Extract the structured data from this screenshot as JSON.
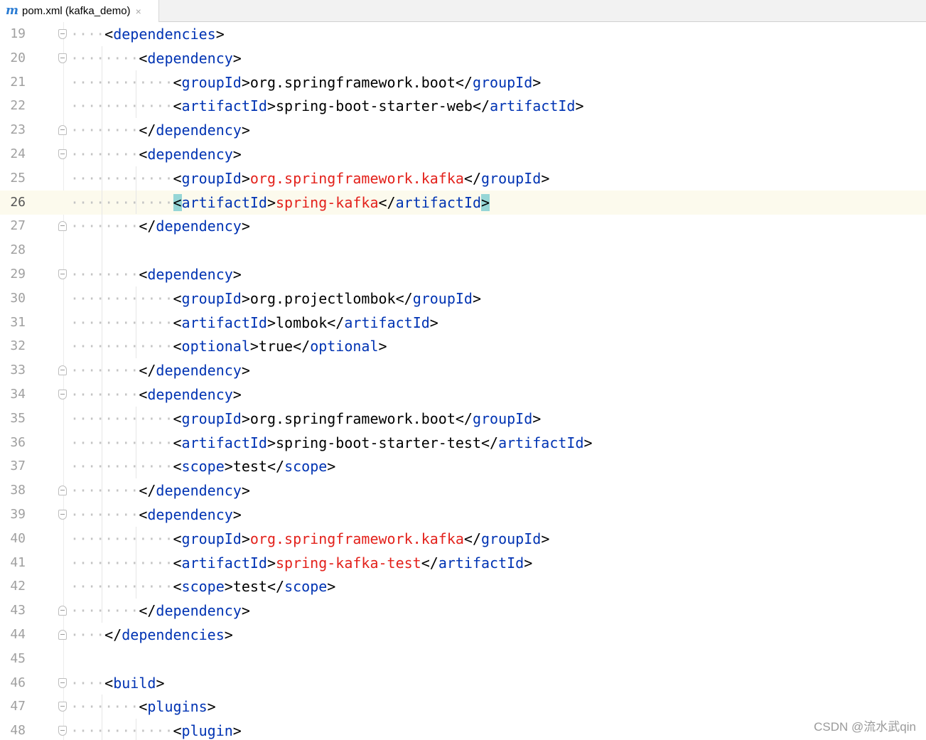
{
  "tab": {
    "icon": "maven-icon",
    "icon_glyph": "m",
    "title": "pom.xml (kafka_demo)",
    "close": "×"
  },
  "editor": {
    "current_line": "26",
    "lines": [
      {
        "no": "19",
        "dots": "····",
        "parts": [
          [
            "p",
            "<"
          ],
          [
            "t",
            "dependencies"
          ],
          [
            "p",
            ">"
          ]
        ]
      },
      {
        "no": "20",
        "dots": "········",
        "parts": [
          [
            "p",
            "<"
          ],
          [
            "t",
            "dependency"
          ],
          [
            "p",
            ">"
          ]
        ]
      },
      {
        "no": "21",
        "dots": "············",
        "parts": [
          [
            "p",
            "<"
          ],
          [
            "t",
            "groupId"
          ],
          [
            "p",
            ">"
          ],
          [
            "v",
            "org.springframework.boot"
          ],
          [
            "p",
            "</"
          ],
          [
            "t",
            "groupId"
          ],
          [
            "p",
            ">"
          ]
        ]
      },
      {
        "no": "22",
        "dots": "············",
        "parts": [
          [
            "p",
            "<"
          ],
          [
            "t",
            "artifactId"
          ],
          [
            "p",
            ">"
          ],
          [
            "v",
            "spring-boot-starter-web"
          ],
          [
            "p",
            "</"
          ],
          [
            "t",
            "artifactId"
          ],
          [
            "p",
            ">"
          ]
        ]
      },
      {
        "no": "23",
        "dots": "········",
        "parts": [
          [
            "p",
            "</"
          ],
          [
            "t",
            "dependency"
          ],
          [
            "p",
            ">"
          ]
        ]
      },
      {
        "no": "24",
        "dots": "········",
        "parts": [
          [
            "p",
            "<"
          ],
          [
            "t",
            "dependency"
          ],
          [
            "p",
            ">"
          ]
        ]
      },
      {
        "no": "25",
        "dots": "············",
        "parts": [
          [
            "p",
            "<"
          ],
          [
            "t",
            "groupId"
          ],
          [
            "p",
            ">"
          ],
          [
            "k",
            "org.springframework.kafka"
          ],
          [
            "p",
            "</"
          ],
          [
            "t",
            "groupId"
          ],
          [
            "p",
            ">"
          ]
        ]
      },
      {
        "no": "26",
        "dots": "············",
        "parts": [
          [
            "b",
            "<"
          ],
          [
            "t",
            "artifactId"
          ],
          [
            "p",
            ">"
          ],
          [
            "k",
            "spring-kafka"
          ],
          [
            "p",
            "</"
          ],
          [
            "t",
            "artifactId"
          ],
          [
            "b",
            ">"
          ]
        ]
      },
      {
        "no": "27",
        "dots": "········",
        "parts": [
          [
            "p",
            "</"
          ],
          [
            "t",
            "dependency"
          ],
          [
            "p",
            ">"
          ]
        ]
      },
      {
        "no": "28",
        "dots": "",
        "parts": []
      },
      {
        "no": "29",
        "dots": "········",
        "parts": [
          [
            "p",
            "<"
          ],
          [
            "t",
            "dependency"
          ],
          [
            "p",
            ">"
          ]
        ]
      },
      {
        "no": "30",
        "dots": "············",
        "parts": [
          [
            "p",
            "<"
          ],
          [
            "t",
            "groupId"
          ],
          [
            "p",
            ">"
          ],
          [
            "v",
            "org.projectlombok"
          ],
          [
            "p",
            "</"
          ],
          [
            "t",
            "groupId"
          ],
          [
            "p",
            ">"
          ]
        ]
      },
      {
        "no": "31",
        "dots": "············",
        "parts": [
          [
            "p",
            "<"
          ],
          [
            "t",
            "artifactId"
          ],
          [
            "p",
            ">"
          ],
          [
            "v",
            "lombok"
          ],
          [
            "p",
            "</"
          ],
          [
            "t",
            "artifactId"
          ],
          [
            "p",
            ">"
          ]
        ]
      },
      {
        "no": "32",
        "dots": "············",
        "parts": [
          [
            "p",
            "<"
          ],
          [
            "t",
            "optional"
          ],
          [
            "p",
            ">"
          ],
          [
            "v",
            "true"
          ],
          [
            "p",
            "</"
          ],
          [
            "t",
            "optional"
          ],
          [
            "p",
            ">"
          ]
        ]
      },
      {
        "no": "33",
        "dots": "········",
        "parts": [
          [
            "p",
            "</"
          ],
          [
            "t",
            "dependency"
          ],
          [
            "p",
            ">"
          ]
        ]
      },
      {
        "no": "34",
        "dots": "········",
        "parts": [
          [
            "p",
            "<"
          ],
          [
            "t",
            "dependency"
          ],
          [
            "p",
            ">"
          ]
        ]
      },
      {
        "no": "35",
        "dots": "············",
        "parts": [
          [
            "p",
            "<"
          ],
          [
            "t",
            "groupId"
          ],
          [
            "p",
            ">"
          ],
          [
            "v",
            "org.springframework.boot"
          ],
          [
            "p",
            "</"
          ],
          [
            "t",
            "groupId"
          ],
          [
            "p",
            ">"
          ]
        ]
      },
      {
        "no": "36",
        "dots": "············",
        "parts": [
          [
            "p",
            "<"
          ],
          [
            "t",
            "artifactId"
          ],
          [
            "p",
            ">"
          ],
          [
            "v",
            "spring-boot-starter-test"
          ],
          [
            "p",
            "</"
          ],
          [
            "t",
            "artifactId"
          ],
          [
            "p",
            ">"
          ]
        ]
      },
      {
        "no": "37",
        "dots": "············",
        "parts": [
          [
            "p",
            "<"
          ],
          [
            "t",
            "scope"
          ],
          [
            "p",
            ">"
          ],
          [
            "v",
            "test"
          ],
          [
            "p",
            "</"
          ],
          [
            "t",
            "scope"
          ],
          [
            "p",
            ">"
          ]
        ]
      },
      {
        "no": "38",
        "dots": "········",
        "parts": [
          [
            "p",
            "</"
          ],
          [
            "t",
            "dependency"
          ],
          [
            "p",
            ">"
          ]
        ]
      },
      {
        "no": "39",
        "dots": "········",
        "parts": [
          [
            "p",
            "<"
          ],
          [
            "t",
            "dependency"
          ],
          [
            "p",
            ">"
          ]
        ]
      },
      {
        "no": "40",
        "dots": "············",
        "parts": [
          [
            "p",
            "<"
          ],
          [
            "t",
            "groupId"
          ],
          [
            "p",
            ">"
          ],
          [
            "k",
            "org.springframework.kafka"
          ],
          [
            "p",
            "</"
          ],
          [
            "t",
            "groupId"
          ],
          [
            "p",
            ">"
          ]
        ]
      },
      {
        "no": "41",
        "dots": "············",
        "parts": [
          [
            "p",
            "<"
          ],
          [
            "t",
            "artifactId"
          ],
          [
            "p",
            ">"
          ],
          [
            "k",
            "spring-kafka-test"
          ],
          [
            "p",
            "</"
          ],
          [
            "t",
            "artifactId"
          ],
          [
            "p",
            ">"
          ]
        ]
      },
      {
        "no": "42",
        "dots": "············",
        "parts": [
          [
            "p",
            "<"
          ],
          [
            "t",
            "scope"
          ],
          [
            "p",
            ">"
          ],
          [
            "v",
            "test"
          ],
          [
            "p",
            "</"
          ],
          [
            "t",
            "scope"
          ],
          [
            "p",
            ">"
          ]
        ]
      },
      {
        "no": "43",
        "dots": "········",
        "parts": [
          [
            "p",
            "</"
          ],
          [
            "t",
            "dependency"
          ],
          [
            "p",
            ">"
          ]
        ]
      },
      {
        "no": "44",
        "dots": "····",
        "parts": [
          [
            "p",
            "</"
          ],
          [
            "t",
            "dependencies"
          ],
          [
            "p",
            ">"
          ]
        ]
      },
      {
        "no": "45",
        "dots": "",
        "parts": []
      },
      {
        "no": "46",
        "dots": "····",
        "parts": [
          [
            "p",
            "<"
          ],
          [
            "t",
            "build"
          ],
          [
            "p",
            ">"
          ]
        ]
      },
      {
        "no": "47",
        "dots": "········",
        "parts": [
          [
            "p",
            "<"
          ],
          [
            "t",
            "plugins"
          ],
          [
            "p",
            ">"
          ]
        ]
      },
      {
        "no": "48",
        "dots": "············",
        "parts": [
          [
            "p",
            "<"
          ],
          [
            "t",
            "plugin"
          ],
          [
            "p",
            ">"
          ]
        ]
      }
    ]
  },
  "colors": {
    "tag": "#0033b3",
    "text": "#000000",
    "highlighted_value": "#e3211b",
    "current_line_bg": "#fcfaed",
    "brace_match": "#96d6d6"
  },
  "watermark": "CSDN @流水武qin"
}
